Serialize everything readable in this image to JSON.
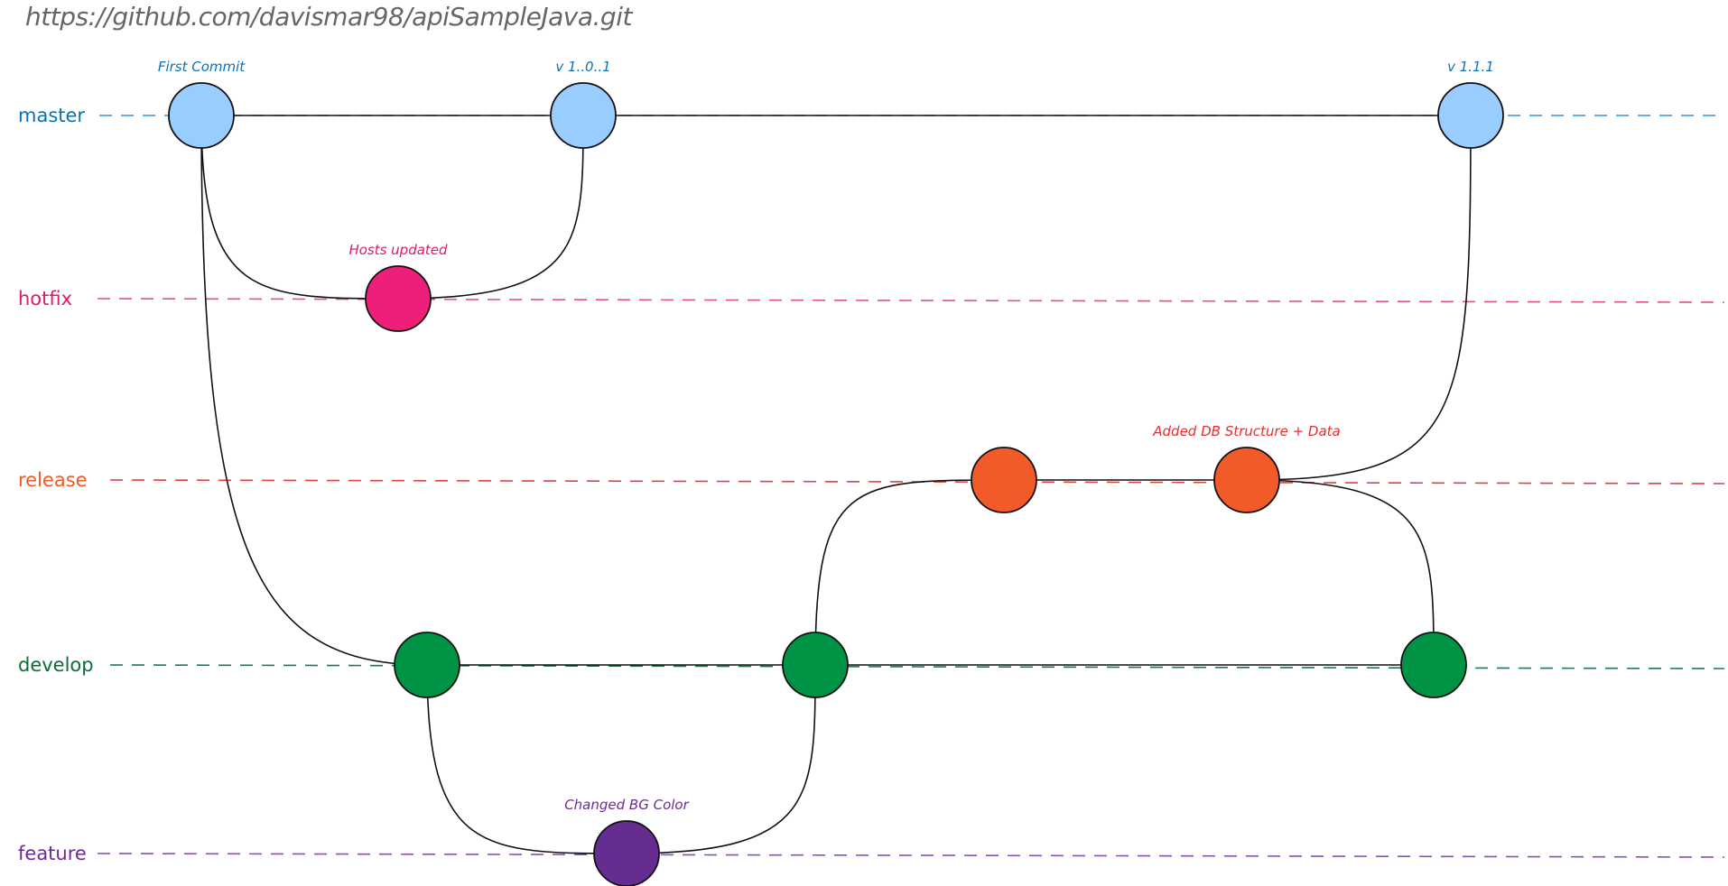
{
  "repo_url": "https://github.com/davismar98/apiSampleJava.git",
  "branches": [
    {
      "id": "master",
      "label": "master",
      "color": "#0b72b5",
      "line_color": "#3a8fcf",
      "node_fill": "#99ccff"
    },
    {
      "id": "hotfix",
      "label": "hotfix",
      "color": "#dd1b6a",
      "line_color": "#e0508a",
      "node_fill": "#ee1f78"
    },
    {
      "id": "release",
      "label": "release",
      "color": "#f05a28",
      "line_color": "#e04040",
      "node_fill": "#f15a29"
    },
    {
      "id": "develop",
      "label": "develop",
      "color": "#0b6e3a",
      "line_color": "#1f7a4a",
      "node_fill": "#009245"
    },
    {
      "id": "feature",
      "label": "feature",
      "color": "#6a2c91",
      "line_color": "#8a4dbb",
      "node_fill": "#662d91"
    }
  ],
  "commits": [
    {
      "id": "m1",
      "branch": "master",
      "label": "First Commit",
      "label_color": "#0b72b5"
    },
    {
      "id": "m2",
      "branch": "master",
      "label": "v 1..0..1",
      "label_color": "#0b72b5"
    },
    {
      "id": "m3",
      "branch": "master",
      "label": "v 1.1.1",
      "label_color": "#0b72b5"
    },
    {
      "id": "h1",
      "branch": "hotfix",
      "label": "Hosts updated",
      "label_color": "#dd1b6a"
    },
    {
      "id": "r1",
      "branch": "release",
      "label": "",
      "label_color": "#ee2a2a"
    },
    {
      "id": "r2",
      "branch": "release",
      "label": "Added DB Structure + Data",
      "label_color": "#ee2a2a"
    },
    {
      "id": "d1",
      "branch": "develop",
      "label": "",
      "label_color": "#0b6e3a"
    },
    {
      "id": "d2",
      "branch": "develop",
      "label": "",
      "label_color": "#0b6e3a"
    },
    {
      "id": "d3",
      "branch": "develop",
      "label": "",
      "label_color": "#0b6e3a"
    },
    {
      "id": "f1",
      "branch": "feature",
      "label": "Changed BG Color",
      "label_color": "#6a2c91"
    }
  ],
  "edges": [
    [
      "m1",
      "m2"
    ],
    [
      "m2",
      "m3"
    ],
    [
      "m1",
      "h1"
    ],
    [
      "h1",
      "m2"
    ],
    [
      "m1",
      "d1"
    ],
    [
      "d1",
      "d2"
    ],
    [
      "d2",
      "d3"
    ],
    [
      "d1",
      "f1"
    ],
    [
      "f1",
      "d2"
    ],
    [
      "d2",
      "r1"
    ],
    [
      "r1",
      "r2"
    ],
    [
      "r2",
      "m3"
    ],
    [
      "r2",
      "d3"
    ]
  ]
}
